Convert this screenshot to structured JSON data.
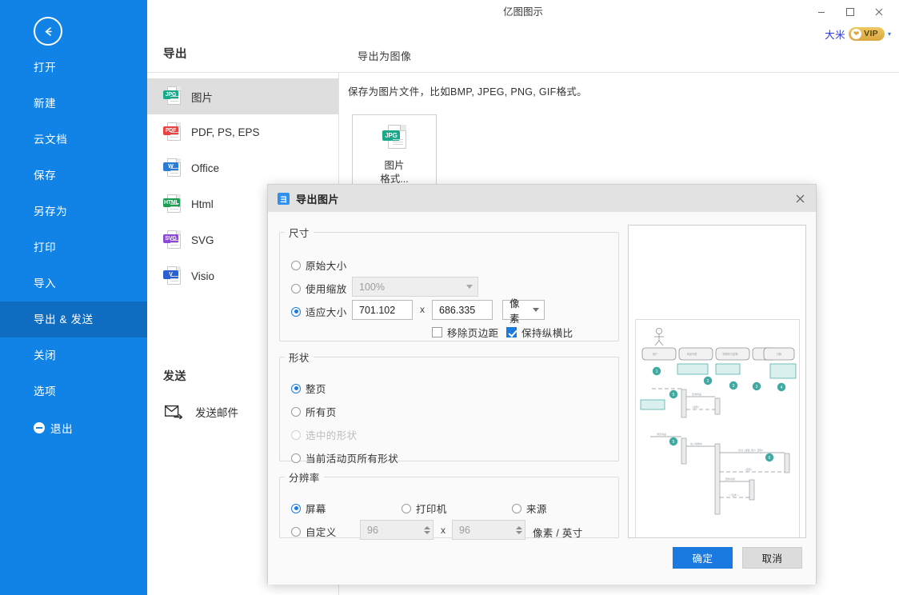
{
  "window": {
    "title": "亿图图示",
    "minimize": "–",
    "maximize": "□",
    "close": "✕"
  },
  "account": {
    "user_name": "大米",
    "vip_label": "VIP",
    "caret": "▾"
  },
  "sidebar": {
    "back_label": "返回",
    "items": [
      {
        "label": "打开",
        "active": false
      },
      {
        "label": "新建",
        "active": false
      },
      {
        "label": "云文档",
        "active": false
      },
      {
        "label": "保存",
        "active": false
      },
      {
        "label": "另存为",
        "active": false
      },
      {
        "label": "打印",
        "active": false
      },
      {
        "label": "导入",
        "active": false
      },
      {
        "label": "导出 & 发送",
        "active": true
      },
      {
        "label": "关闭",
        "active": false
      },
      {
        "label": "选项",
        "active": false
      }
    ],
    "exit_label": "退出"
  },
  "export_panel": {
    "header": "导出",
    "right_header": "导出为图像",
    "description": "保存为图片文件，比如BMP, JPEG, PNG, GIF格式。",
    "formats": [
      {
        "label": "图片",
        "tag": "JPG",
        "color": "#1aa88b",
        "active": true
      },
      {
        "label": "PDF, PS, EPS",
        "tag": "PDF",
        "color": "#e8433f",
        "active": false
      },
      {
        "label": "Office",
        "tag": "W",
        "color": "#2b7cd3",
        "active": false
      },
      {
        "label": "Html",
        "tag": "HTML",
        "color": "#1a9e52",
        "active": false
      },
      {
        "label": "SVG",
        "tag": "SVG",
        "color": "#8a4ad6",
        "active": false
      },
      {
        "label": "Visio",
        "tag": "V",
        "color": "#2b5fd0",
        "active": false
      }
    ],
    "card": {
      "tag": "JPG",
      "title": "图片",
      "subtitle": "格式..."
    },
    "send_header": "发送",
    "send_mail_label": "发送邮件"
  },
  "dialog": {
    "title": "导出图片",
    "close": "✕",
    "size_group": {
      "legend": "尺寸",
      "original_label": "原始大小",
      "original_selected": false,
      "scale_label": "使用缩放",
      "scale_selected": false,
      "scale_value": "100%",
      "fit_label": "适应大小",
      "fit_selected": true,
      "width_value": "701.102",
      "height_value": "686.335",
      "x_sep": "x",
      "unit_value": "像素",
      "remove_margin_label": "移除页边距",
      "remove_margin_checked": false,
      "keep_ratio_label": "保持纵横比",
      "keep_ratio_checked": true
    },
    "shape_group": {
      "legend": "形状",
      "options": [
        {
          "label": "整页",
          "selected": true,
          "disabled": false
        },
        {
          "label": "所有页",
          "selected": false,
          "disabled": false
        },
        {
          "label": "选中的形状",
          "selected": false,
          "disabled": true
        },
        {
          "label": "当前活动页所有形状",
          "selected": false,
          "disabled": false
        }
      ]
    },
    "resolution_group": {
      "legend": "分辨率",
      "screen_label": "屏幕",
      "screen_selected": true,
      "printer_label": "打印机",
      "printer_selected": false,
      "source_label": "来源",
      "source_selected": false,
      "custom_label": "自定义",
      "custom_selected": false,
      "dpi_x": "96",
      "dpi_y": "96",
      "x_sep": "x",
      "dpi_unit": "像素 / 英寸"
    },
    "preview_alt": "UML 时序图预览",
    "ok_label": "确定",
    "cancel_label": "取消"
  }
}
